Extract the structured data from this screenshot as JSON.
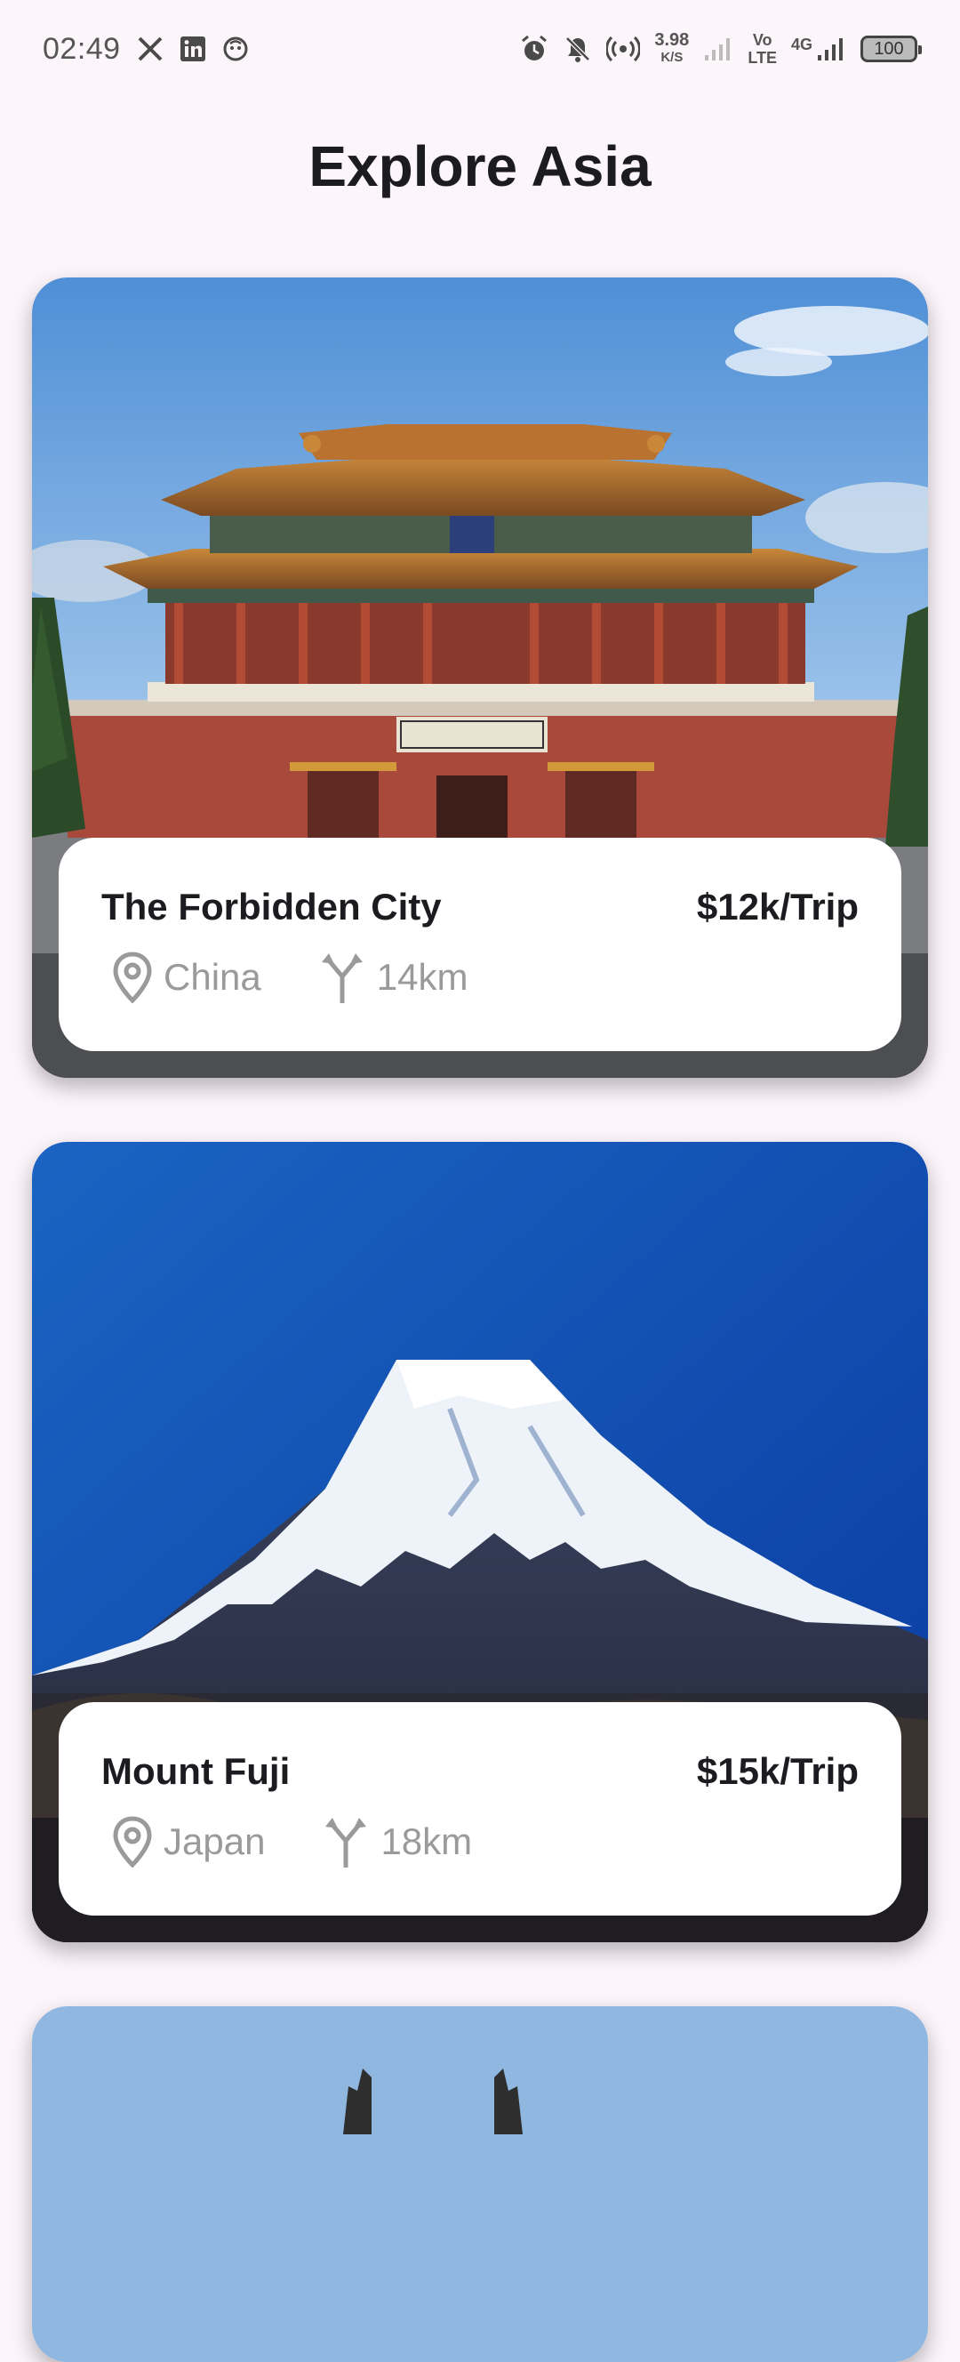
{
  "status_bar": {
    "time": "02:49",
    "icons": [
      "x-icon",
      "linkedin-icon",
      "notification-app-icon"
    ],
    "right_icons": [
      "alarm-icon",
      "mute-icon",
      "hotspot-icon",
      "signal-icon",
      "volte-icon",
      "4g-signal-icon",
      "battery-icon"
    ],
    "speed_value": "3.98",
    "speed_unit": "K/S",
    "volte_top": "Vo",
    "volte_bottom": "LTE",
    "network": "4G",
    "battery": "100"
  },
  "header": {
    "title": "Explore Asia"
  },
  "destinations": [
    {
      "name": "The Forbidden City",
      "price": "$12k/Trip",
      "country": "China",
      "distance": "14km",
      "location_icon": "location-pin-icon",
      "distance_icon": "route-split-icon"
    },
    {
      "name": "Mount Fuji",
      "price": "$15k/Trip",
      "country": "Japan",
      "distance": "18km",
      "location_icon": "location-pin-icon",
      "distance_icon": "route-split-icon"
    }
  ],
  "colors": {
    "background": "#fcf5fa",
    "card_info_bg": "#ffffff",
    "text_primary": "#1c1b1f",
    "text_muted": "#9a9a9a"
  }
}
